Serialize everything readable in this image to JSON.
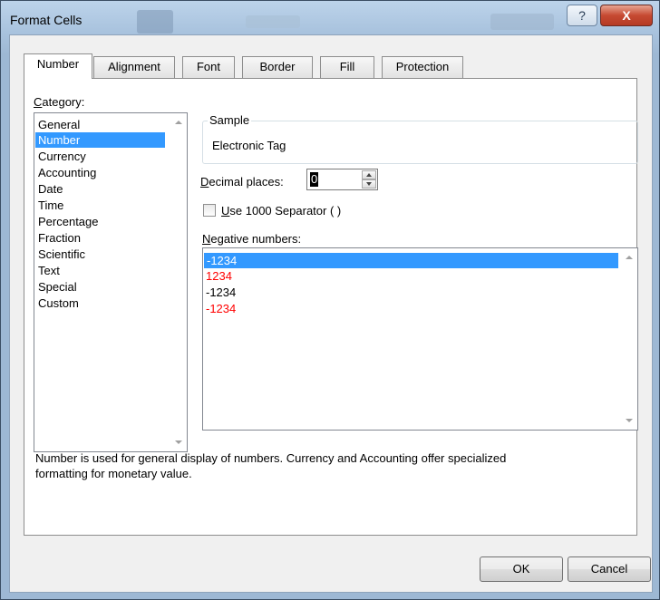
{
  "window": {
    "title": "Format Cells",
    "help_label": "?",
    "close_label": "X"
  },
  "tabs": [
    {
      "label": "Number",
      "active": true
    },
    {
      "label": "Alignment",
      "active": false
    },
    {
      "label": "Font",
      "active": false
    },
    {
      "label": "Border",
      "active": false
    },
    {
      "label": "Fill",
      "active": false
    },
    {
      "label": "Protection",
      "active": false
    }
  ],
  "category": {
    "label_prefix": "C",
    "label_rest": "ategory:",
    "items": [
      "General",
      "Number",
      "Currency",
      "Accounting",
      "Date",
      "Time",
      "Percentage",
      "Fraction",
      "Scientific",
      "Text",
      "Special",
      "Custom"
    ],
    "selected": "Number"
  },
  "sample": {
    "legend": "Sample",
    "value": "Electronic Tag"
  },
  "decimal": {
    "label_prefix": "D",
    "label_rest": "ecimal places:",
    "value": "0"
  },
  "separator": {
    "label_prefix": "U",
    "label_rest": "se 1000 Separator ( )",
    "checked": false
  },
  "negative": {
    "label_prefix": "N",
    "label_rest": "egative numbers:",
    "items": [
      {
        "text": "-1234",
        "color": "#000000",
        "selected": true
      },
      {
        "text": "1234",
        "color": "#ff0000",
        "selected": false
      },
      {
        "text": "-1234",
        "color": "#000000",
        "selected": false
      },
      {
        "text": "-1234",
        "color": "#ff0000",
        "selected": false
      }
    ]
  },
  "description": {
    "line1": "Number is used for general display of numbers.  Currency and Accounting offer specialized",
    "line2": "formatting for monetary value."
  },
  "buttons": {
    "ok": "OK",
    "cancel": "Cancel"
  },
  "colors": {
    "selection": "#3399ff",
    "negative_red": "#ff0000"
  }
}
